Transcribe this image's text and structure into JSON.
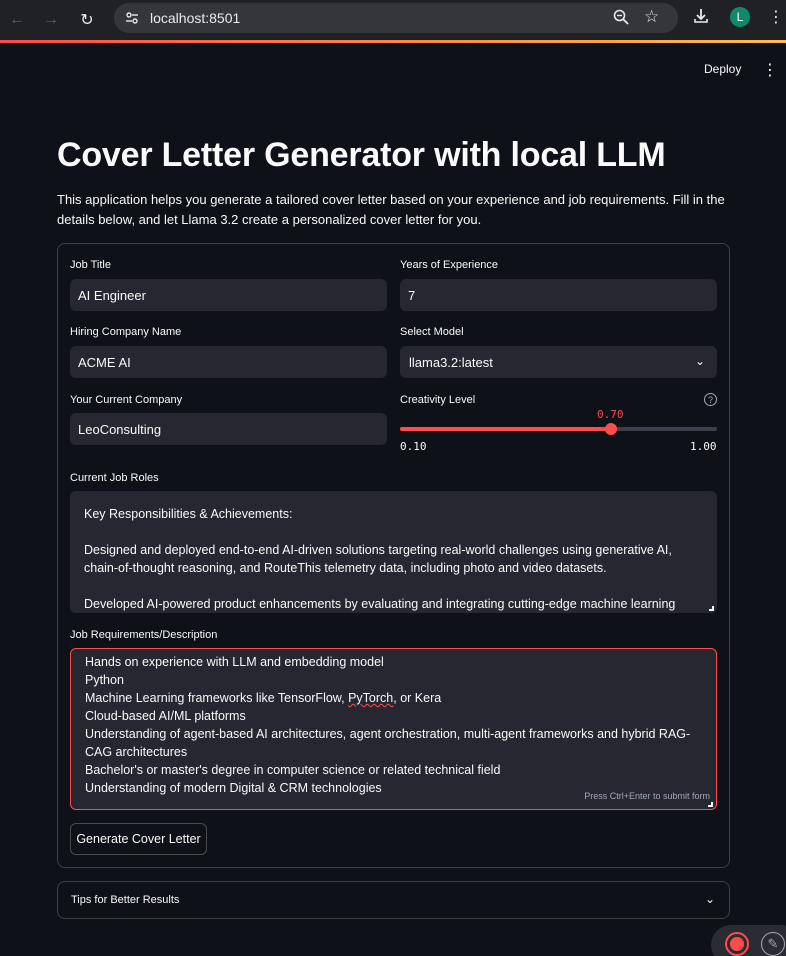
{
  "browser": {
    "url": "localhost:8501",
    "profile_initial": "L"
  },
  "header": {
    "deploy_label": "Deploy"
  },
  "page": {
    "title": "Cover Letter Generator with local LLM",
    "description": "This application helps you generate a tailored cover letter based on your experience and job requirements. Fill in the details below, and let Llama 3.2 create a personalized cover letter for you."
  },
  "form": {
    "job_title": {
      "label": "Job Title",
      "value": "AI Engineer"
    },
    "years_experience": {
      "label": "Years of Experience",
      "value": "7"
    },
    "hiring_company": {
      "label": "Hiring Company Name",
      "value": "ACME AI"
    },
    "model": {
      "label": "Select Model",
      "value": "llama3.2:latest"
    },
    "current_company": {
      "label": "Your Current Company",
      "value": "LeoConsulting"
    },
    "creativity": {
      "label": "Creativity Level",
      "value": 0.7,
      "value_text": "0.70",
      "min": "0.10",
      "max": "1.00"
    },
    "current_roles": {
      "label": "Current Job Roles",
      "lines": [
        "Key Responsibilities & Achievements:",
        "",
        "Designed and deployed end-to-end AI-driven solutions targeting real-world challenges using generative AI, chain-of-thought reasoning, and RouteThis telemetry data, including photo and video datasets.",
        "",
        "Developed AI-powered product enhancements by evaluating and integrating cutting-edge machine learning"
      ]
    },
    "job_requirements": {
      "label": "Job Requirements/Description",
      "lines": [
        "Hands on experience with LLM and embedding model",
        "Python",
        "Machine Learning frameworks like TensorFlow, PyTorch, or Kera",
        "Cloud-based AI/ML platforms",
        "Understanding of agent-based AI architectures, agent orchestration, multi-agent frameworks and hybrid RAG-CAG architectures",
        "Bachelor's or master's degree in computer science or related technical field",
        "Understanding of modern Digital & CRM technologies"
      ],
      "hint": "Press Ctrl+Enter to submit form"
    },
    "submit_label": "Generate Cover Letter"
  },
  "expander": {
    "label": "Tips for Better Results"
  },
  "colors": {
    "background": "#0e1117",
    "input_bg": "#262730",
    "accent": "#ff4b4b"
  }
}
